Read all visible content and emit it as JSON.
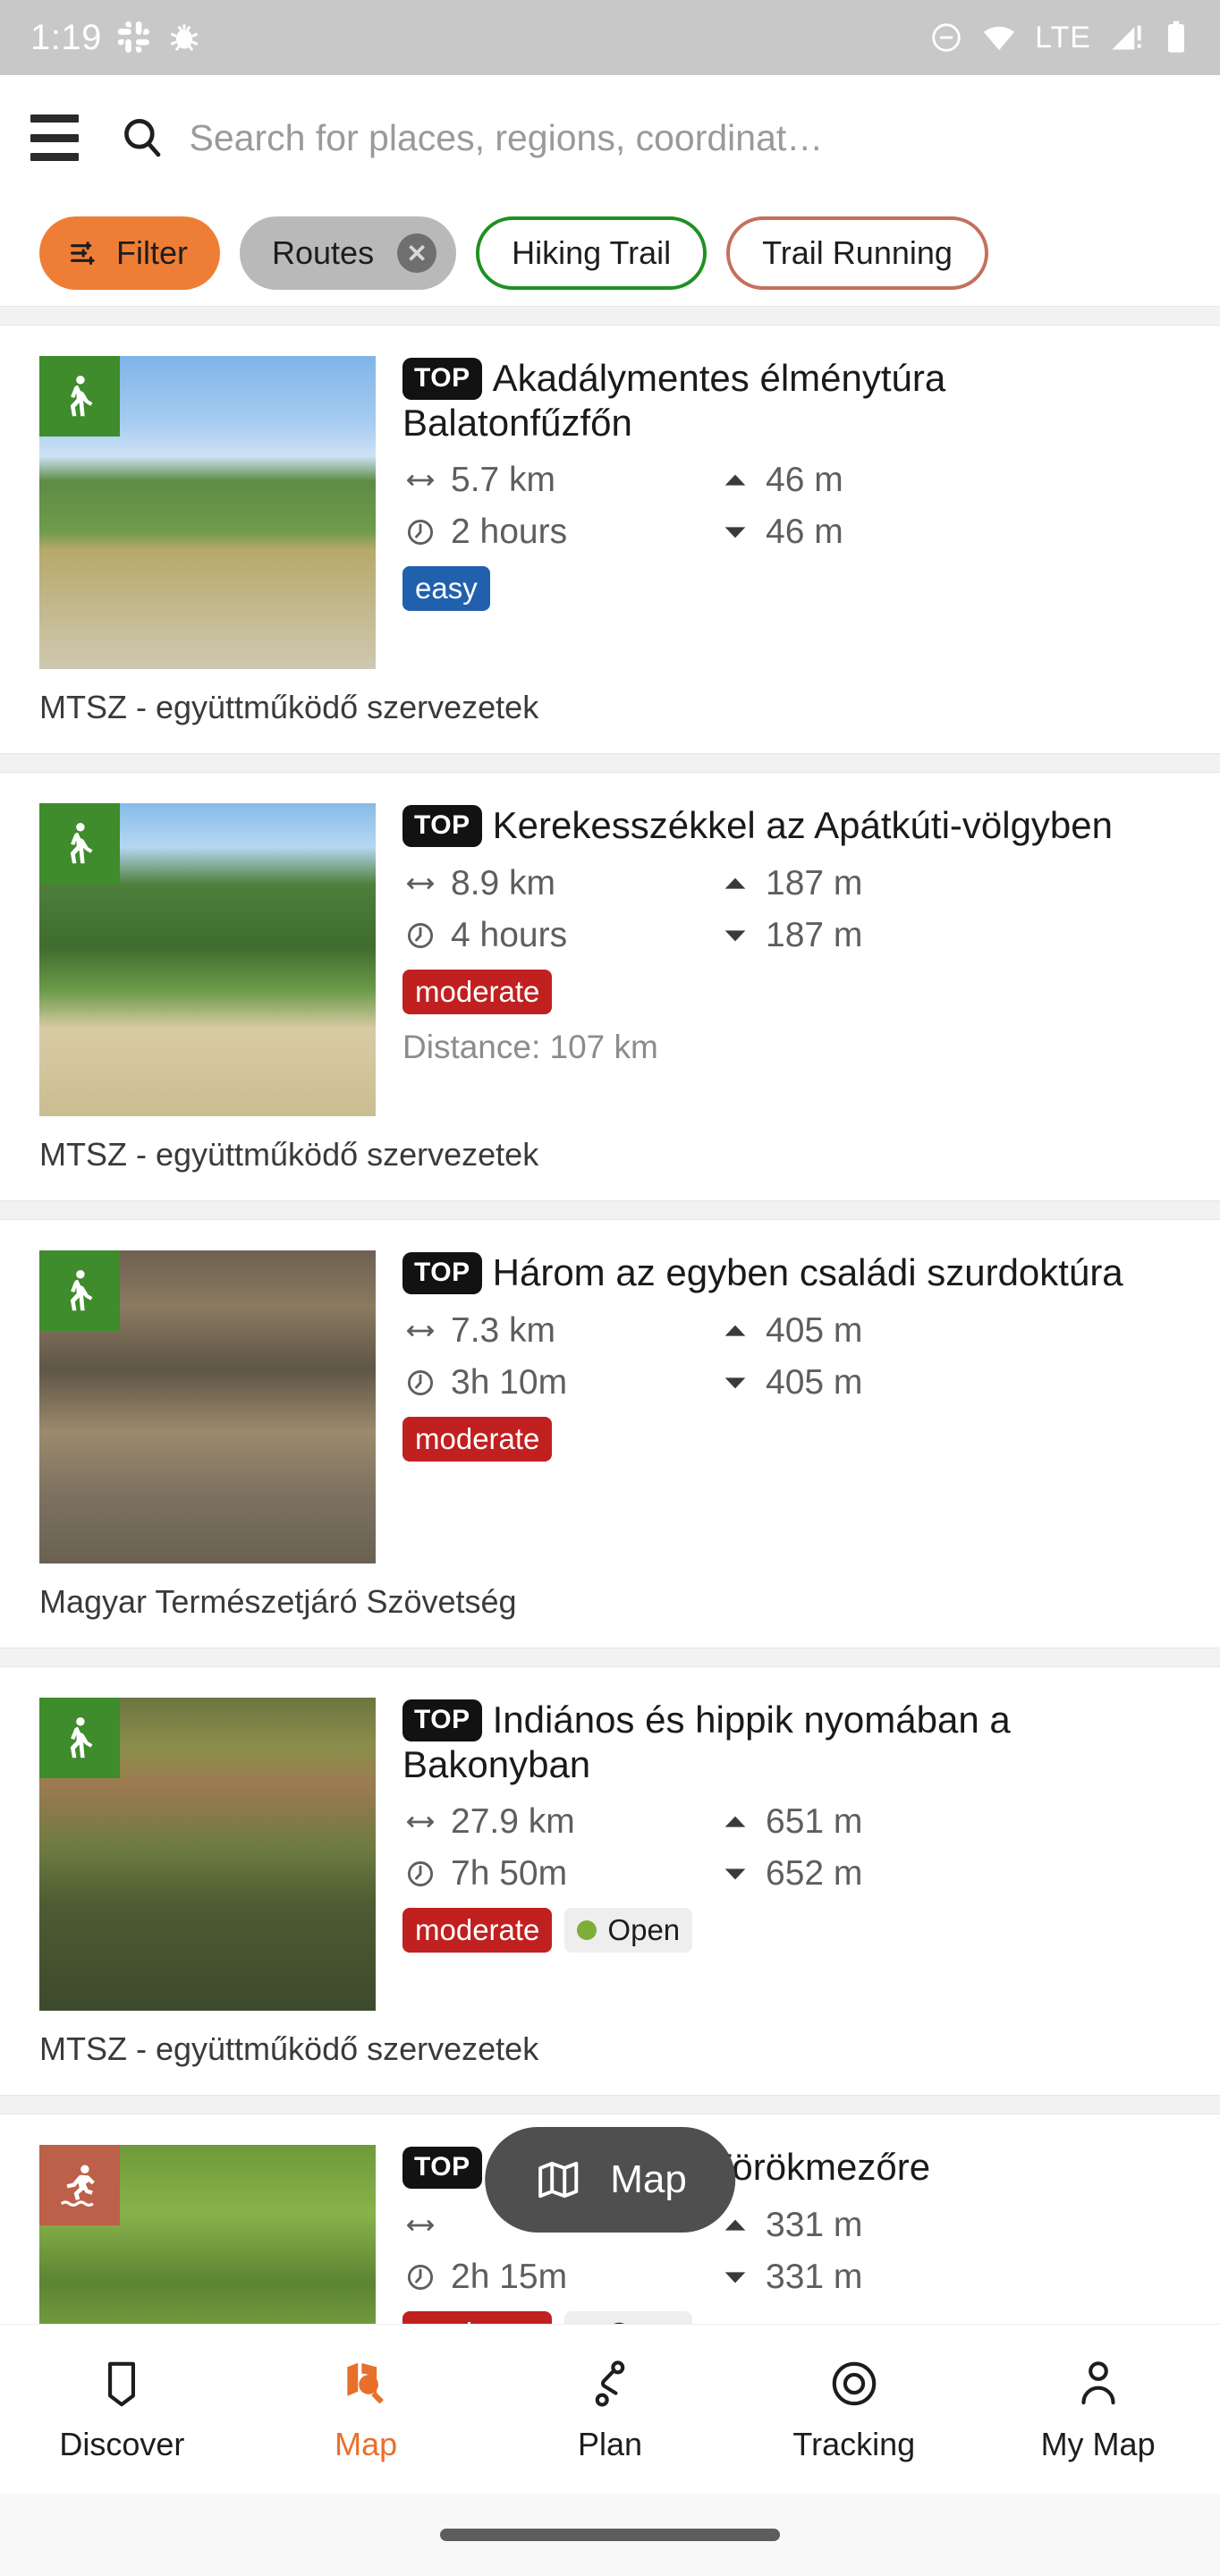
{
  "status_bar": {
    "time": "1:19",
    "left_icons": [
      "slack-icon",
      "bug-icon"
    ],
    "right_icons": [
      "dnd-icon",
      "wifi-icon",
      "signal-icon",
      "battery-icon"
    ],
    "network_label": "LTE"
  },
  "search": {
    "placeholder": "Search for places, regions, coordinat…",
    "value": "",
    "menu_icon": "hamburger-icon",
    "search_icon": "search-icon"
  },
  "chips": [
    {
      "label": "Filter",
      "style": "filled-orange",
      "icon": "sliders-icon",
      "removable": false
    },
    {
      "label": "Routes",
      "style": "filled-grey",
      "icon": "",
      "removable": true,
      "remove_label": "✕"
    },
    {
      "label": "Hiking Trail",
      "style": "outline-green",
      "icon": "",
      "removable": false
    },
    {
      "label": "Trail Running",
      "style": "outline-red",
      "icon": "",
      "removable": false
    }
  ],
  "accent_colors": {
    "orange": "#ee7e36",
    "brand_orange": "#e8702a",
    "green": "#1f9022",
    "red_outline": "#c4705c",
    "badge_easy": "#2160ad",
    "badge_moderate": "#c12020",
    "open_dot": "#7fae38",
    "type_hiking": "#3e8c2b",
    "type_running": "#bd6049"
  },
  "results": [
    {
      "top_badge": "TOP",
      "title": "Akadálymentes élménytúra Balatonfűzfőn",
      "distance": "5.7 km",
      "duration": "2 hours",
      "ascent": "46 m",
      "descent": "46 m",
      "difficulty": "easy",
      "difficulty_style": "easy",
      "status": "",
      "sub_line": "",
      "source": "MTSZ - együttműködő szervezetek",
      "activity_icon": "hiking-icon",
      "activity_color": "green",
      "photo": "ph1"
    },
    {
      "top_badge": "TOP",
      "title": "Kerekesszékkel az Apátkúti-völgyben",
      "distance": "8.9 km",
      "duration": "4 hours",
      "ascent": "187 m",
      "descent": "187 m",
      "difficulty": "moderate",
      "difficulty_style": "moderate",
      "status": "",
      "sub_line": "Distance: 107 km",
      "source": "MTSZ - együttműködő szervezetek",
      "activity_icon": "hiking-icon",
      "activity_color": "green",
      "photo": "ph2"
    },
    {
      "top_badge": "TOP",
      "title": "Három az egyben családi szurdoktúra",
      "distance": "7.3 km",
      "duration": "3h 10m",
      "ascent": "405 m",
      "descent": "405 m",
      "difficulty": "moderate",
      "difficulty_style": "moderate",
      "status": "",
      "sub_line": "",
      "source": "Magyar Természetjáró Szövetség",
      "activity_icon": "hiking-icon",
      "activity_color": "green",
      "photo": "ph3"
    },
    {
      "top_badge": "TOP",
      "title": "Indiános és hippik nyomában a Bakonyban",
      "distance": "27.9 km",
      "duration": "7h 50m",
      "ascent": "651 m",
      "descent": "652 m",
      "difficulty": "moderate",
      "difficulty_style": "moderate",
      "status": "Open",
      "sub_line": "",
      "source": "MTSZ - együttműködő szervezetek",
      "activity_icon": "hiking-icon",
      "activity_color": "green",
      "photo": "ph4"
    },
    {
      "top_badge": "TOP",
      "title": "Kóspallagról Törökmezőre",
      "distance": "",
      "duration": "2h 15m",
      "ascent": "331 m",
      "descent": "331 m",
      "difficulty": "moderate",
      "difficulty_style": "moderate",
      "status": "Open",
      "sub_line": "",
      "source": "",
      "activity_icon": "trail-running-icon",
      "activity_color": "orange",
      "photo": "ph5"
    }
  ],
  "map_fab": {
    "label": "Map",
    "icon": "map-icon"
  },
  "bottom_nav": {
    "items": [
      {
        "label": "Discover",
        "icon": "bookmark-icon",
        "active": false
      },
      {
        "label": "Map",
        "icon": "map-search-icon",
        "active": true
      },
      {
        "label": "Plan",
        "icon": "route-icon",
        "active": false
      },
      {
        "label": "Tracking",
        "icon": "target-icon",
        "active": false
      },
      {
        "label": "My Map",
        "icon": "person-icon",
        "active": false
      }
    ]
  }
}
